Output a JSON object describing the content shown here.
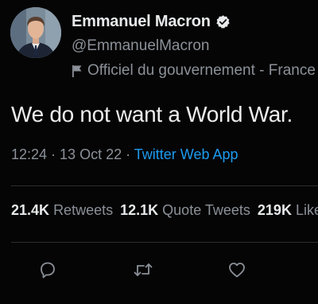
{
  "author": {
    "display_name": "Emmanuel Macron",
    "handle": "@EmmanuelMacron",
    "affiliation": "Officiel du gouvernement - France",
    "verified": true
  },
  "tweet": {
    "text": "We do not want a World War.",
    "time": "12:24",
    "separator1": " · ",
    "date": "13 Oct 22",
    "separator2": " · ",
    "source": "Twitter Web App"
  },
  "stats": {
    "retweets_count": "21.4K",
    "retweets_label": "Retweets",
    "quotes_count": "12.1K",
    "quotes_label": "Quote Tweets",
    "likes_count": "219K",
    "likes_label": "Likes"
  },
  "actions": {
    "reply": "reply-icon",
    "retweet": "retweet-icon",
    "like": "heart-icon"
  },
  "colors": {
    "background": "#050505",
    "link": "#1d9bf0",
    "muted": "#8b9198",
    "text": "#e7e9ea"
  }
}
